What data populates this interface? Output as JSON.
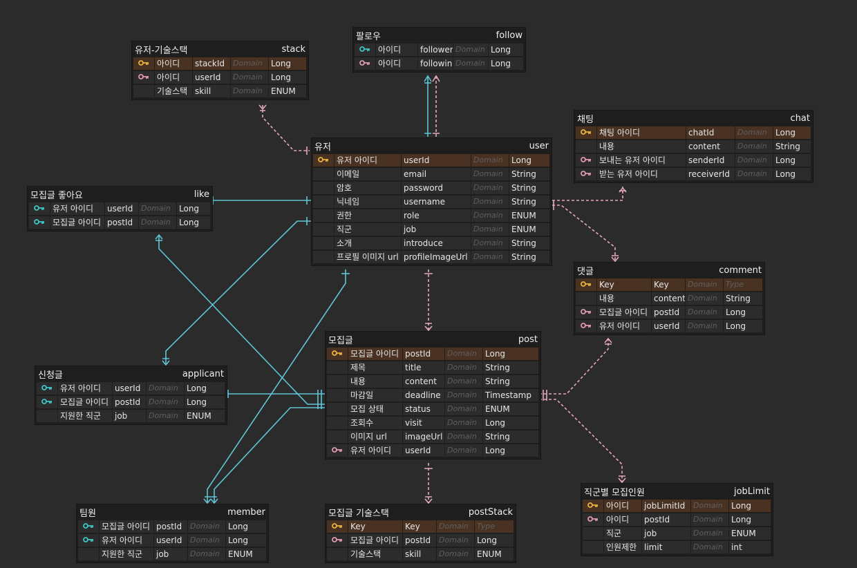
{
  "colors": {
    "background": "#2b2b2b",
    "table_background": "#1e1e1e",
    "pk_row": "#4a3222",
    "primary_key_icon": "#e9b43a",
    "pk_fk_key_icon": "#3ec7c7",
    "foreign_key_icon": "#e39aae",
    "identifying_relation": "#5fc6d6",
    "non_identifying_relation": "#e8a9bd"
  },
  "tables": [
    {
      "id": "stack",
      "logical": "유저-기술스택",
      "physical": "stack",
      "columns": [
        {
          "key": "pk",
          "logical": "아이디",
          "physical": "stackId",
          "domain": "Domain",
          "type": "Long"
        },
        {
          "key": "fk",
          "logical": "아이디",
          "physical": "userId",
          "domain": "Domain",
          "type": "Long"
        },
        {
          "key": "",
          "logical": "기술스택",
          "physical": "skill",
          "domain": "Domain",
          "type": "ENUM"
        }
      ]
    },
    {
      "id": "follow",
      "logical": "팔로우",
      "physical": "follow",
      "columns": [
        {
          "key": "fkpk",
          "logical": "아이디",
          "physical": "follower",
          "domain": "Domain",
          "type": "Long"
        },
        {
          "key": "fk",
          "logical": "아이디",
          "physical": "following",
          "domain": "Domain",
          "type": "Long"
        }
      ]
    },
    {
      "id": "chat",
      "logical": "채팅",
      "physical": "chat",
      "columns": [
        {
          "key": "pk",
          "logical": "채팅 아이디",
          "physical": "chatId",
          "domain": "Domain",
          "type": "Long"
        },
        {
          "key": "",
          "logical": "내용",
          "physical": "content",
          "domain": "Domain",
          "type": "String"
        },
        {
          "key": "fk",
          "logical": "보내는 유저 아이디",
          "physical": "senderId",
          "domain": "Domain",
          "type": "Long"
        },
        {
          "key": "fk",
          "logical": "받는 유저 아이디",
          "physical": "receiverId",
          "domain": "Domain",
          "type": "Long"
        }
      ]
    },
    {
      "id": "user",
      "logical": "유저",
      "physical": "user",
      "columns": [
        {
          "key": "pk",
          "logical": "유저 아이디",
          "physical": "userId",
          "domain": "Domain",
          "type": "Long"
        },
        {
          "key": "",
          "logical": "이메일",
          "physical": "email",
          "domain": "Domain",
          "type": "String"
        },
        {
          "key": "",
          "logical": "암호",
          "physical": "password",
          "domain": "Domain",
          "type": "String"
        },
        {
          "key": "",
          "logical": "닉네임",
          "physical": "username",
          "domain": "Domain",
          "type": "String"
        },
        {
          "key": "",
          "logical": "권한",
          "physical": "role",
          "domain": "Domain",
          "type": "ENUM"
        },
        {
          "key": "",
          "logical": "직군",
          "physical": "job",
          "domain": "Domain",
          "type": "ENUM"
        },
        {
          "key": "",
          "logical": "소개",
          "physical": "introduce",
          "domain": "Domain",
          "type": "String"
        },
        {
          "key": "",
          "logical": "프로필 이미지 url",
          "physical": "profileImageUrl",
          "domain": "Domain",
          "type": "String"
        }
      ]
    },
    {
      "id": "like",
      "logical": "모집글 좋아요",
      "physical": "like",
      "columns": [
        {
          "key": "fkpk",
          "logical": "유저 아이디",
          "physical": "userId",
          "domain": "Domain",
          "type": "Long"
        },
        {
          "key": "fkpk",
          "logical": "모집글 아이디",
          "physical": "postId",
          "domain": "Domain",
          "type": "Long"
        }
      ]
    },
    {
      "id": "comment",
      "logical": "댓글",
      "physical": "comment",
      "columns": [
        {
          "key": "pk",
          "logical": "Key",
          "physical": "Key",
          "domain": "Domain",
          "type": "Type"
        },
        {
          "key": "",
          "logical": "내용",
          "physical": "content",
          "domain": "Domain",
          "type": "String"
        },
        {
          "key": "fk",
          "logical": "모집글 아이디",
          "physical": "postId",
          "domain": "Domain",
          "type": "Long"
        },
        {
          "key": "fk",
          "logical": "유저 아이디",
          "physical": "userId",
          "domain": "Domain",
          "type": "Long"
        }
      ]
    },
    {
      "id": "post",
      "logical": "모집글",
      "physical": "post",
      "columns": [
        {
          "key": "pk",
          "logical": "모집글 아이디",
          "physical": "postId",
          "domain": "Domain",
          "type": "Long"
        },
        {
          "key": "",
          "logical": "제목",
          "physical": "title",
          "domain": "Domain",
          "type": "String"
        },
        {
          "key": "",
          "logical": "내용",
          "physical": "content",
          "domain": "Domain",
          "type": "String"
        },
        {
          "key": "",
          "logical": "마감일",
          "physical": "deadline",
          "domain": "Domain",
          "type": "Timestamp"
        },
        {
          "key": "",
          "logical": "모집 상태",
          "physical": "status",
          "domain": "Domain",
          "type": "ENUM"
        },
        {
          "key": "",
          "logical": "조회수",
          "physical": "visit",
          "domain": "Domain",
          "type": "Long"
        },
        {
          "key": "",
          "logical": "이미지 url",
          "physical": "imageUrl",
          "domain": "Domain",
          "type": "String"
        },
        {
          "key": "fk",
          "logical": "유저 아이디",
          "physical": "userId",
          "domain": "Domain",
          "type": "Long"
        }
      ]
    },
    {
      "id": "applicant",
      "logical": "신청글",
      "physical": "applicant",
      "columns": [
        {
          "key": "fkpk",
          "logical": "유저 아이디",
          "physical": "userId",
          "domain": "Domain",
          "type": "Long"
        },
        {
          "key": "fkpk",
          "logical": "모집글 아이디",
          "physical": "postId",
          "domain": "Domain",
          "type": "Long"
        },
        {
          "key": "",
          "logical": "지원한 직군",
          "physical": "job",
          "domain": "Domain",
          "type": "ENUM"
        }
      ]
    },
    {
      "id": "member",
      "logical": "팀원",
      "physical": "member",
      "columns": [
        {
          "key": "fkpk",
          "logical": "모집글 아이디",
          "physical": "postId",
          "domain": "Domain",
          "type": "Long"
        },
        {
          "key": "fkpk",
          "logical": "유저 아이디",
          "physical": "userId",
          "domain": "Domain",
          "type": "Long"
        },
        {
          "key": "",
          "logical": "지원한 직군",
          "physical": "job",
          "domain": "Domain",
          "type": "ENUM"
        }
      ]
    },
    {
      "id": "postStack",
      "logical": "모집글 기술스택",
      "physical": "postStack",
      "columns": [
        {
          "key": "pk",
          "logical": "Key",
          "physical": "Key",
          "domain": "Domain",
          "type": "Type"
        },
        {
          "key": "fk",
          "logical": "모집글 아이디",
          "physical": "postId",
          "domain": "Domain",
          "type": "Long"
        },
        {
          "key": "",
          "logical": "기술스택",
          "physical": "skill",
          "domain": "Domain",
          "type": "ENUM"
        }
      ]
    },
    {
      "id": "jobLimit",
      "logical": "직군별 모집인원",
      "physical": "jobLimit",
      "columns": [
        {
          "key": "pk",
          "logical": "아이디",
          "physical": "jobLimitId",
          "domain": "Domain",
          "type": "Long"
        },
        {
          "key": "fk",
          "logical": "아이디",
          "physical": "postId",
          "domain": "Domain",
          "type": "Long"
        },
        {
          "key": "",
          "logical": "직군",
          "physical": "job",
          "domain": "Domain",
          "type": "ENUM"
        },
        {
          "key": "",
          "logical": "인원제한",
          "physical": "limit",
          "domain": "Domain",
          "type": "int"
        }
      ]
    }
  ],
  "relations": [
    {
      "from": "user",
      "to": "stack",
      "style": "non-identifying"
    },
    {
      "from": "user",
      "to": "follow",
      "style": "identifying"
    },
    {
      "from": "user",
      "to": "follow",
      "style": "non-identifying"
    },
    {
      "from": "user",
      "to": "chat",
      "style": "non-identifying"
    },
    {
      "from": "user",
      "to": "comment",
      "style": "non-identifying"
    },
    {
      "from": "user",
      "to": "like",
      "style": "identifying"
    },
    {
      "from": "user",
      "to": "applicant",
      "style": "identifying"
    },
    {
      "from": "user",
      "to": "member",
      "style": "identifying"
    },
    {
      "from": "user",
      "to": "post",
      "style": "non-identifying"
    },
    {
      "from": "post",
      "to": "like",
      "style": "identifying"
    },
    {
      "from": "post",
      "to": "applicant",
      "style": "identifying"
    },
    {
      "from": "post",
      "to": "member",
      "style": "identifying"
    },
    {
      "from": "post",
      "to": "comment",
      "style": "non-identifying"
    },
    {
      "from": "post",
      "to": "jobLimit",
      "style": "non-identifying"
    },
    {
      "from": "post",
      "to": "postStack",
      "style": "non-identifying"
    }
  ]
}
